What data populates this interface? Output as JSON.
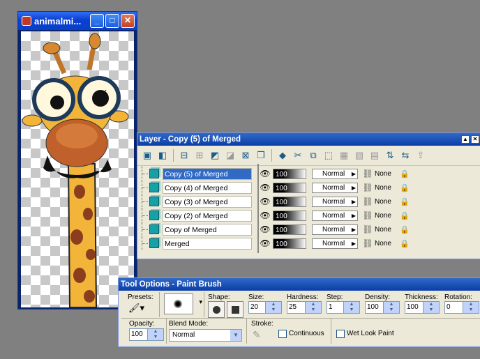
{
  "image_window": {
    "title": "animalmi...",
    "buttons": {
      "minimize": "_",
      "maximize": "□",
      "close": "✕"
    }
  },
  "layer_palette": {
    "title": "Layer - Copy (5) of Merged",
    "layers": [
      {
        "name": "Copy (5) of Merged",
        "opacity": "100",
        "blend": "Normal",
        "link": "None",
        "selected": true
      },
      {
        "name": "Copy (4) of Merged",
        "opacity": "100",
        "blend": "Normal",
        "link": "None",
        "selected": false
      },
      {
        "name": "Copy (3) of Merged",
        "opacity": "100",
        "blend": "Normal",
        "link": "None",
        "selected": false
      },
      {
        "name": "Copy (2) of Merged",
        "opacity": "100",
        "blend": "Normal",
        "link": "None",
        "selected": false
      },
      {
        "name": "Copy of Merged",
        "opacity": "100",
        "blend": "Normal",
        "link": "None",
        "selected": false
      },
      {
        "name": "Merged",
        "opacity": "100",
        "blend": "Normal",
        "link": "None",
        "selected": false
      }
    ]
  },
  "tool_options": {
    "title": "Tool Options - Paint Brush",
    "presets_label": "Presets:",
    "shape_label": "Shape:",
    "size_label": "Size:",
    "size_value": "20",
    "hardness_label": "Hardness:",
    "hardness_value": "25",
    "step_label": "Step:",
    "step_value": "1",
    "density_label": "Density:",
    "density_value": "100",
    "thickness_label": "Thickness:",
    "thickness_value": "100",
    "rotation_label": "Rotation:",
    "rotation_value": "0",
    "opacity_label": "Opacity:",
    "opacity_value": "100",
    "blend_label": "Blend Mode:",
    "blend_value": "Normal",
    "stroke_label": "Stroke:",
    "continuous_label": "Continuous",
    "wetlook_label": "Wet Look Paint"
  }
}
